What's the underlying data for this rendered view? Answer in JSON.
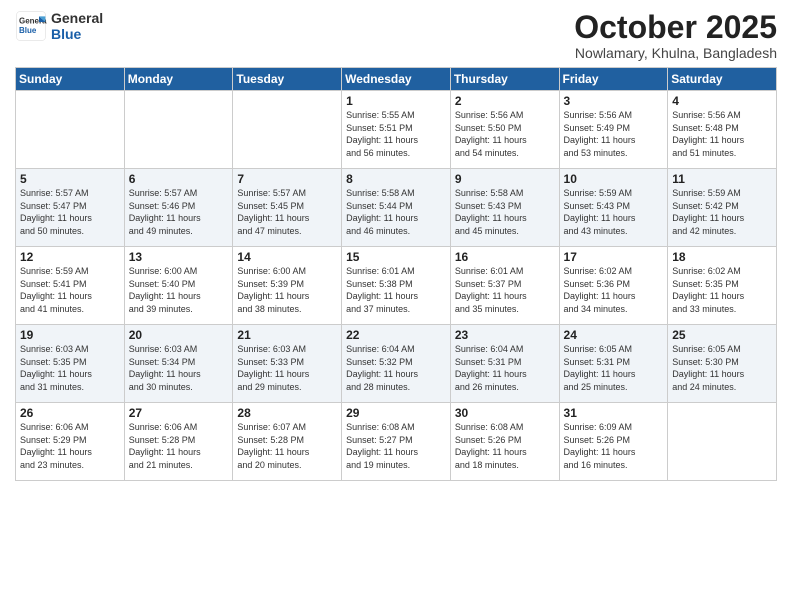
{
  "header": {
    "logo_line1": "General",
    "logo_line2": "Blue",
    "month": "October 2025",
    "location": "Nowlamary, Khulna, Bangladesh"
  },
  "days_of_week": [
    "Sunday",
    "Monday",
    "Tuesday",
    "Wednesday",
    "Thursday",
    "Friday",
    "Saturday"
  ],
  "weeks": [
    [
      {
        "day": "",
        "info": ""
      },
      {
        "day": "",
        "info": ""
      },
      {
        "day": "",
        "info": ""
      },
      {
        "day": "1",
        "info": "Sunrise: 5:55 AM\nSunset: 5:51 PM\nDaylight: 11 hours\nand 56 minutes."
      },
      {
        "day": "2",
        "info": "Sunrise: 5:56 AM\nSunset: 5:50 PM\nDaylight: 11 hours\nand 54 minutes."
      },
      {
        "day": "3",
        "info": "Sunrise: 5:56 AM\nSunset: 5:49 PM\nDaylight: 11 hours\nand 53 minutes."
      },
      {
        "day": "4",
        "info": "Sunrise: 5:56 AM\nSunset: 5:48 PM\nDaylight: 11 hours\nand 51 minutes."
      }
    ],
    [
      {
        "day": "5",
        "info": "Sunrise: 5:57 AM\nSunset: 5:47 PM\nDaylight: 11 hours\nand 50 minutes."
      },
      {
        "day": "6",
        "info": "Sunrise: 5:57 AM\nSunset: 5:46 PM\nDaylight: 11 hours\nand 49 minutes."
      },
      {
        "day": "7",
        "info": "Sunrise: 5:57 AM\nSunset: 5:45 PM\nDaylight: 11 hours\nand 47 minutes."
      },
      {
        "day": "8",
        "info": "Sunrise: 5:58 AM\nSunset: 5:44 PM\nDaylight: 11 hours\nand 46 minutes."
      },
      {
        "day": "9",
        "info": "Sunrise: 5:58 AM\nSunset: 5:43 PM\nDaylight: 11 hours\nand 45 minutes."
      },
      {
        "day": "10",
        "info": "Sunrise: 5:59 AM\nSunset: 5:43 PM\nDaylight: 11 hours\nand 43 minutes."
      },
      {
        "day": "11",
        "info": "Sunrise: 5:59 AM\nSunset: 5:42 PM\nDaylight: 11 hours\nand 42 minutes."
      }
    ],
    [
      {
        "day": "12",
        "info": "Sunrise: 5:59 AM\nSunset: 5:41 PM\nDaylight: 11 hours\nand 41 minutes."
      },
      {
        "day": "13",
        "info": "Sunrise: 6:00 AM\nSunset: 5:40 PM\nDaylight: 11 hours\nand 39 minutes."
      },
      {
        "day": "14",
        "info": "Sunrise: 6:00 AM\nSunset: 5:39 PM\nDaylight: 11 hours\nand 38 minutes."
      },
      {
        "day": "15",
        "info": "Sunrise: 6:01 AM\nSunset: 5:38 PM\nDaylight: 11 hours\nand 37 minutes."
      },
      {
        "day": "16",
        "info": "Sunrise: 6:01 AM\nSunset: 5:37 PM\nDaylight: 11 hours\nand 35 minutes."
      },
      {
        "day": "17",
        "info": "Sunrise: 6:02 AM\nSunset: 5:36 PM\nDaylight: 11 hours\nand 34 minutes."
      },
      {
        "day": "18",
        "info": "Sunrise: 6:02 AM\nSunset: 5:35 PM\nDaylight: 11 hours\nand 33 minutes."
      }
    ],
    [
      {
        "day": "19",
        "info": "Sunrise: 6:03 AM\nSunset: 5:35 PM\nDaylight: 11 hours\nand 31 minutes."
      },
      {
        "day": "20",
        "info": "Sunrise: 6:03 AM\nSunset: 5:34 PM\nDaylight: 11 hours\nand 30 minutes."
      },
      {
        "day": "21",
        "info": "Sunrise: 6:03 AM\nSunset: 5:33 PM\nDaylight: 11 hours\nand 29 minutes."
      },
      {
        "day": "22",
        "info": "Sunrise: 6:04 AM\nSunset: 5:32 PM\nDaylight: 11 hours\nand 28 minutes."
      },
      {
        "day": "23",
        "info": "Sunrise: 6:04 AM\nSunset: 5:31 PM\nDaylight: 11 hours\nand 26 minutes."
      },
      {
        "day": "24",
        "info": "Sunrise: 6:05 AM\nSunset: 5:31 PM\nDaylight: 11 hours\nand 25 minutes."
      },
      {
        "day": "25",
        "info": "Sunrise: 6:05 AM\nSunset: 5:30 PM\nDaylight: 11 hours\nand 24 minutes."
      }
    ],
    [
      {
        "day": "26",
        "info": "Sunrise: 6:06 AM\nSunset: 5:29 PM\nDaylight: 11 hours\nand 23 minutes."
      },
      {
        "day": "27",
        "info": "Sunrise: 6:06 AM\nSunset: 5:28 PM\nDaylight: 11 hours\nand 21 minutes."
      },
      {
        "day": "28",
        "info": "Sunrise: 6:07 AM\nSunset: 5:28 PM\nDaylight: 11 hours\nand 20 minutes."
      },
      {
        "day": "29",
        "info": "Sunrise: 6:08 AM\nSunset: 5:27 PM\nDaylight: 11 hours\nand 19 minutes."
      },
      {
        "day": "30",
        "info": "Sunrise: 6:08 AM\nSunset: 5:26 PM\nDaylight: 11 hours\nand 18 minutes."
      },
      {
        "day": "31",
        "info": "Sunrise: 6:09 AM\nSunset: 5:26 PM\nDaylight: 11 hours\nand 16 minutes."
      },
      {
        "day": "",
        "info": ""
      }
    ]
  ]
}
